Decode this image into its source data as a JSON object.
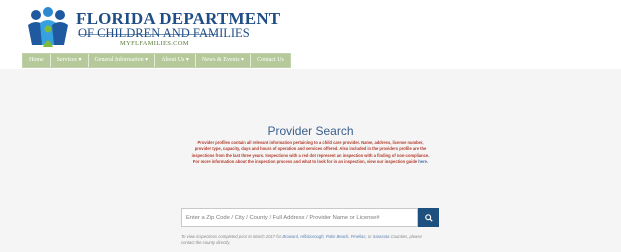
{
  "brand": {
    "line1": "FLORIDA DEPARTMENT",
    "line2": "OF CHILDREN AND FAMILIES",
    "line3": "MYFLFAMILIES.COM"
  },
  "nav": [
    "Home",
    "Services ▾",
    "General Information ▾",
    "About Us ▾",
    "News & Events ▾",
    "Contact Us"
  ],
  "main": {
    "title": "Provider Search",
    "description": "Provider profiles contain all relevant information pertaining to a child care provider. Name, address, license number, provider type, capacity, days and hours of operation and services offered. Also included in the providers profile are the inspections from the last three years. Inspections with a red dot represent an inspection with a finding of non-compliance. For more information about the inspection process and what to look for in an inspection, view our inspection guide",
    "description_link": "here",
    "description_end": "."
  },
  "search": {
    "placeholder": "Enter a Zip Code / City / County / Full Address / Provider Name or License#"
  },
  "note": {
    "prefix": "To view inspections completed prior to March 2017 for ",
    "links": [
      "Broward",
      "Hillsborough",
      "Palm Beach",
      "Pinellas",
      "Sarasota"
    ],
    "suffix": " Counties, please contact the county directly."
  },
  "colors": {
    "brand_blue": "#1f4d86",
    "nav_green": "#b6c99a",
    "title_blue": "#3a5f8c",
    "desc_red": "#b33a2a",
    "search_button": "#1d4f7f"
  },
  "icons": {
    "search_button": "search-icon",
    "logo": "family-logo-icon"
  }
}
